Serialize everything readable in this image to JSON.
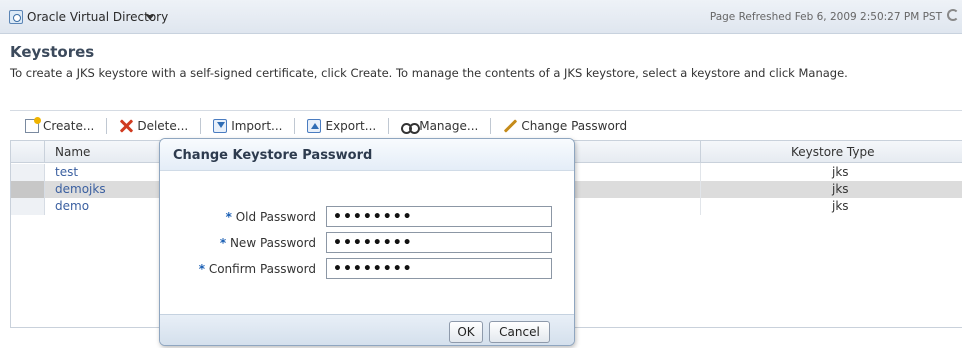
{
  "header": {
    "app_title": "Oracle Virtual Directory",
    "refreshed": "Page Refreshed Feb 6, 2009 2:50:27 PM PST"
  },
  "page": {
    "title": "Keystores",
    "description": "To create a JKS keystore with a self-signed certificate, click Create. To manage the contents of a JKS keystore, select a keystore and click Manage."
  },
  "toolbar": {
    "create": "Create...",
    "delete": "Delete...",
    "import": "Import...",
    "export": "Export...",
    "manage": "Manage...",
    "change_password": "Change Password"
  },
  "table": {
    "columns": {
      "name": "Name",
      "type": "Keystore Type"
    },
    "rows": [
      {
        "name": "test",
        "type": "jks"
      },
      {
        "name": "demojks",
        "type": "jks",
        "selected": true
      },
      {
        "name": "demo",
        "type": "jks"
      }
    ]
  },
  "dialog": {
    "title": "Change Keystore Password",
    "required_mark": "*",
    "fields": {
      "old_label": "Old Password",
      "old_value": "••••••••",
      "new_label": "New Password",
      "new_value": "••••••••",
      "confirm_label": "Confirm Password",
      "confirm_value": "••••••••"
    },
    "ok": "OK",
    "cancel": "Cancel"
  },
  "colors": {
    "link": "#3a5fa0",
    "required": "#1a5fb4",
    "selected_row": "#dcdcdc"
  }
}
